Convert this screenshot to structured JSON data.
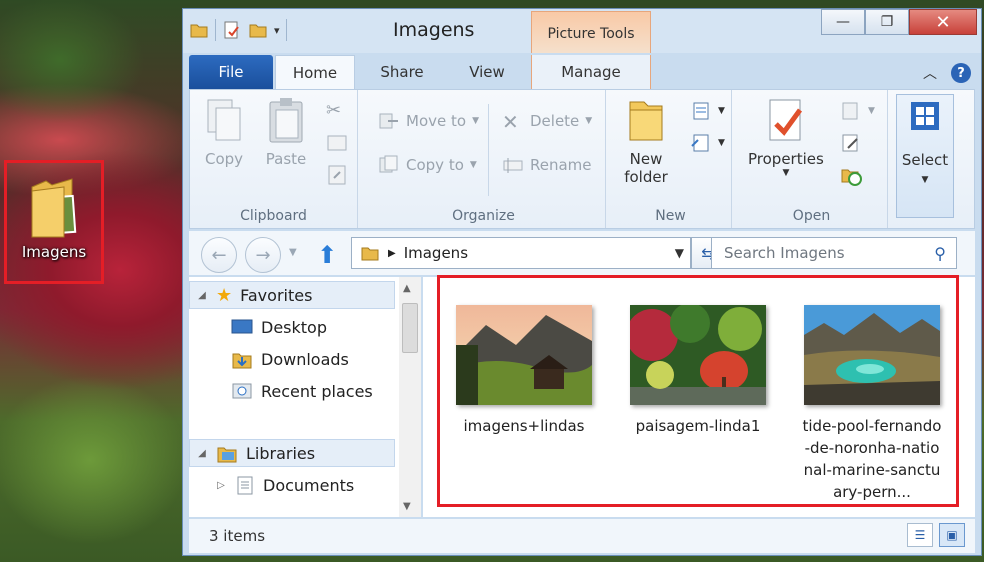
{
  "desktop": {
    "icon_label": "Imagens"
  },
  "window": {
    "title": "Imagens",
    "contextual_tab_group": "Picture Tools",
    "buttons": {
      "minimize": "—",
      "maximize": "❐",
      "close": "✕"
    }
  },
  "tabs": {
    "file": "File",
    "home": "Home",
    "share": "Share",
    "view": "View",
    "manage": "Manage"
  },
  "ribbon": {
    "clipboard": {
      "name": "Clipboard",
      "copy": "Copy",
      "paste": "Paste"
    },
    "organize": {
      "name": "Organize",
      "move_to": "Move to",
      "copy_to": "Copy to",
      "delete": "Delete",
      "rename": "Rename"
    },
    "new": {
      "name": "New",
      "new_folder_line1": "New",
      "new_folder_line2": "folder"
    },
    "open": {
      "name": "Open",
      "properties": "Properties"
    },
    "select": {
      "label": "Select"
    }
  },
  "address": {
    "path": "Imagens",
    "search_placeholder": "Search Imagens"
  },
  "navigation": {
    "favorites": "Favorites",
    "desktop": "Desktop",
    "downloads": "Downloads",
    "recent_places": "Recent places",
    "libraries": "Libraries",
    "documents": "Documents"
  },
  "files": [
    {
      "name": "imagens+lindas"
    },
    {
      "name": "paisagem-linda1"
    },
    {
      "name": "tide-pool-fernando-de-noronha-national-marine-sanctuary-pern..."
    }
  ],
  "status": {
    "item_count": "3 items"
  },
  "colors": {
    "highlight_box": "#e41e26",
    "accent": "#1a4f9c",
    "contextual_tab": "#f9c9a6"
  }
}
